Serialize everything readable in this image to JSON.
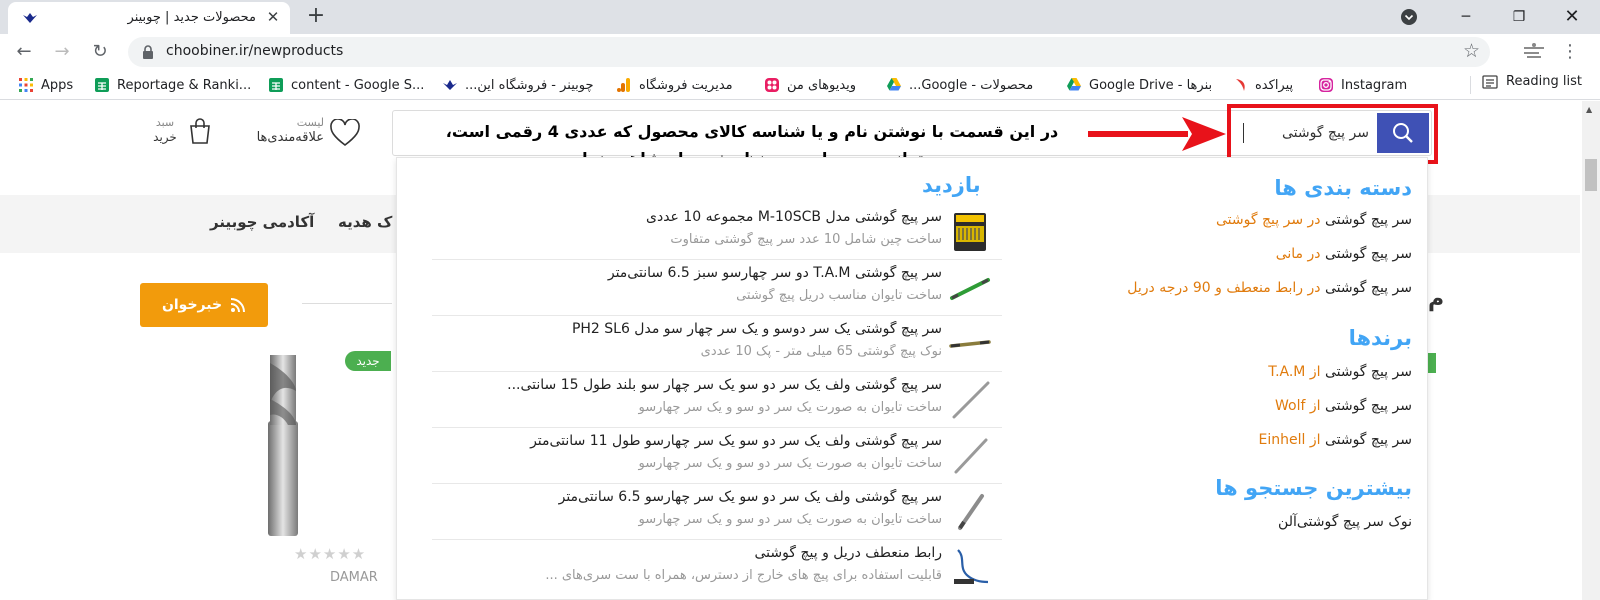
{
  "browser": {
    "tab_title": "محصولات جدید | چوبینر",
    "url": "choobiner.ir/newproducts",
    "bookmarks": [
      {
        "label": "Apps",
        "icon": "apps-grid-icon"
      },
      {
        "label": "Reportage & Ranki...",
        "icon": "google-sheets-icon"
      },
      {
        "label": "content - Google S...",
        "icon": "google-sheets-icon"
      },
      {
        "label": "چوبینر - فروشگاه این...",
        "icon": "choobiner-logo-icon"
      },
      {
        "label": "مدیریت فروشگاه",
        "icon": "google-analytics-icon"
      },
      {
        "label": "ویدیوهای من",
        "icon": "video-app-icon"
      },
      {
        "label": "محصولات - Google...",
        "icon": "google-drive-icon"
      },
      {
        "label": "بنرها - Google Drive",
        "icon": "google-drive-icon"
      },
      {
        "label": "پیراکده",
        "icon": "pirakade-icon"
      },
      {
        "label": "Instagram",
        "icon": "instagram-icon"
      }
    ],
    "reading_list": "Reading list"
  },
  "header": {
    "cart_line1": "سبد",
    "cart_line2": "خرید",
    "wishlist_line1": "لیست",
    "wishlist_line2": "علاقه‌مندی‌ها"
  },
  "nav": {
    "items": [
      "آکادمی چوبینر",
      "ک هدیه"
    ]
  },
  "search": {
    "value": "سر پیچ گوشتی",
    "callout_line1": "در این قسمت با نوشتن نام و یا شناسه کالای محصول که عددی 4 رقمی است،",
    "callout_line2": "می‌توانید محصول مورد نظر خود را مشاهده نمایید."
  },
  "dropdown": {
    "categories_heading": "دسته بندی ها",
    "categories": [
      {
        "term": "سر پیچ گوشتی",
        "rest": " در سر پیچ گوشتی"
      },
      {
        "term": "سر پیچ گوشتی",
        "rest": " در مانی"
      },
      {
        "term": "سر پیچ گوشتی",
        "rest": " در رابط منعطف و 90 درجه دریل"
      }
    ],
    "brands_heading": "برندها",
    "brands": [
      {
        "term": "سر پیچ گوشتی",
        "rest": " از T.A.M"
      },
      {
        "term": "سر پیچ گوشتی",
        "rest": " از Wolf"
      },
      {
        "term": "سر پیچ گوشتی",
        "rest": " از Einhell"
      }
    ],
    "top_searches_heading": "بیشترین جستجو ها",
    "top_searches": [
      "نوک سر پیچ گوشتی‌آلن"
    ],
    "visits_heading": "بازدید",
    "visits": [
      {
        "title": "سر پیچ گوشتی مدل M-10SCB مجموعه 10 عددی",
        "subtitle": "ساخت چین شامل 10 عدد سر پیچ گوشتی متفاوت"
      },
      {
        "title": "سر پیچ گوشتی T.A.M دو سر چهارسو سبز 6.5 سانتی‌متر",
        "subtitle": "ساخت تایوان مناسب دریل پیچ گوشتی"
      },
      {
        "title": "سر پیچ گوشتی یک سر دوسو و یک سر چهار سو مدل PH2 SL6",
        "subtitle": "نوک پیچ گوشتی 65 میلی متر - پک 10 عددی"
      },
      {
        "title": "سر پیچ گوشتی ولف یک سر دو سو یک سر چهار سو بلند طول 15 سانتی...",
        "subtitle": "ساخت تایوان به صورت یک سر دو سو و یک سر چهارسو"
      },
      {
        "title": "سر پیچ گوشتی ولف یک سر دو سو یک سر چهارسو طول 11 سانتی‌متر",
        "subtitle": "ساخت تایوان به صورت یک سر دو سو و یک سر چهارسو"
      },
      {
        "title": "سر پیچ گوشتی ولف یک سر دو سو یک سر چهارسو 6.5 سانتی‌متر",
        "subtitle": "ساخت تایوان به صورت یک سر دو سو و یک سر چهارسو"
      },
      {
        "title": "رابط منعطف دریل و پیچ گوشتی",
        "subtitle": "قابلیت استفاده برای پیچ های خارج از دسترس، همراه با ست سری‌های ..."
      }
    ]
  },
  "page": {
    "rss_button": "خبرخوان",
    "new_badge": "جدید",
    "product_brand": "DAMAR",
    "right_edge_char": "م"
  },
  "colors": {
    "accent_blue": "#3f51b5",
    "link_blue": "#42a5f5",
    "orange": "#f29b0c",
    "highlight_red": "#e8121a"
  }
}
